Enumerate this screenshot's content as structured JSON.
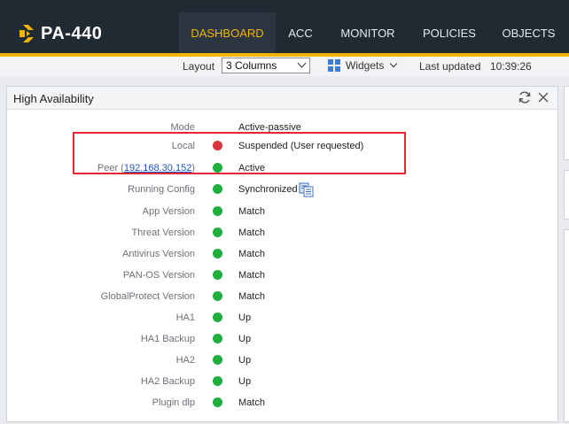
{
  "app": {
    "logo_text": "PA-440"
  },
  "nav": {
    "tabs": [
      {
        "label": "DASHBOARD",
        "active": true
      },
      {
        "label": "ACC",
        "active": false
      },
      {
        "label": "MONITOR",
        "active": false
      },
      {
        "label": "POLICIES",
        "active": false
      },
      {
        "label": "OBJECTS",
        "active": false
      }
    ]
  },
  "toolbar": {
    "layout_label": "Layout",
    "layout_value": "3 Columns",
    "widgets_label": "Widgets",
    "last_updated_label": "Last updated",
    "last_updated_time": "10:39:26"
  },
  "panel": {
    "title": "High Availability",
    "rows": [
      {
        "label": "Mode",
        "status": "none",
        "value": "Active-passive"
      },
      {
        "label": "Local",
        "status": "red",
        "value": "Suspended (User requested)"
      },
      {
        "label_prefix": "Peer (",
        "label_link": "192.168.30.152",
        "label_suffix": ")",
        "status": "green",
        "value": "Active"
      },
      {
        "label": "Running Config",
        "status": "green",
        "value": "Synchronized",
        "icon": "compare-config-icon"
      },
      {
        "label": "App Version",
        "status": "green",
        "value": "Match"
      },
      {
        "label": "Threat Version",
        "status": "green",
        "value": "Match"
      },
      {
        "label": "Antivirus Version",
        "status": "green",
        "value": "Match"
      },
      {
        "label": "PAN-OS Version",
        "status": "green",
        "value": "Match"
      },
      {
        "label": "GlobalProtect Version",
        "status": "green",
        "value": "Match"
      },
      {
        "label": "HA1",
        "status": "green",
        "value": "Up"
      },
      {
        "label": "HA1 Backup",
        "status": "green",
        "value": "Up"
      },
      {
        "label": "HA2",
        "status": "green",
        "value": "Up"
      },
      {
        "label": "HA2 Backup",
        "status": "green",
        "value": "Up"
      },
      {
        "label": "Plugin dlp",
        "status": "green",
        "value": "Match"
      }
    ]
  },
  "colors": {
    "topbar": "#1f2a33",
    "accent": "#f4b400",
    "status_green": "#1fae3f",
    "status_red": "#d9363e",
    "highlight": "#e32a32",
    "link": "#1c55c8"
  }
}
